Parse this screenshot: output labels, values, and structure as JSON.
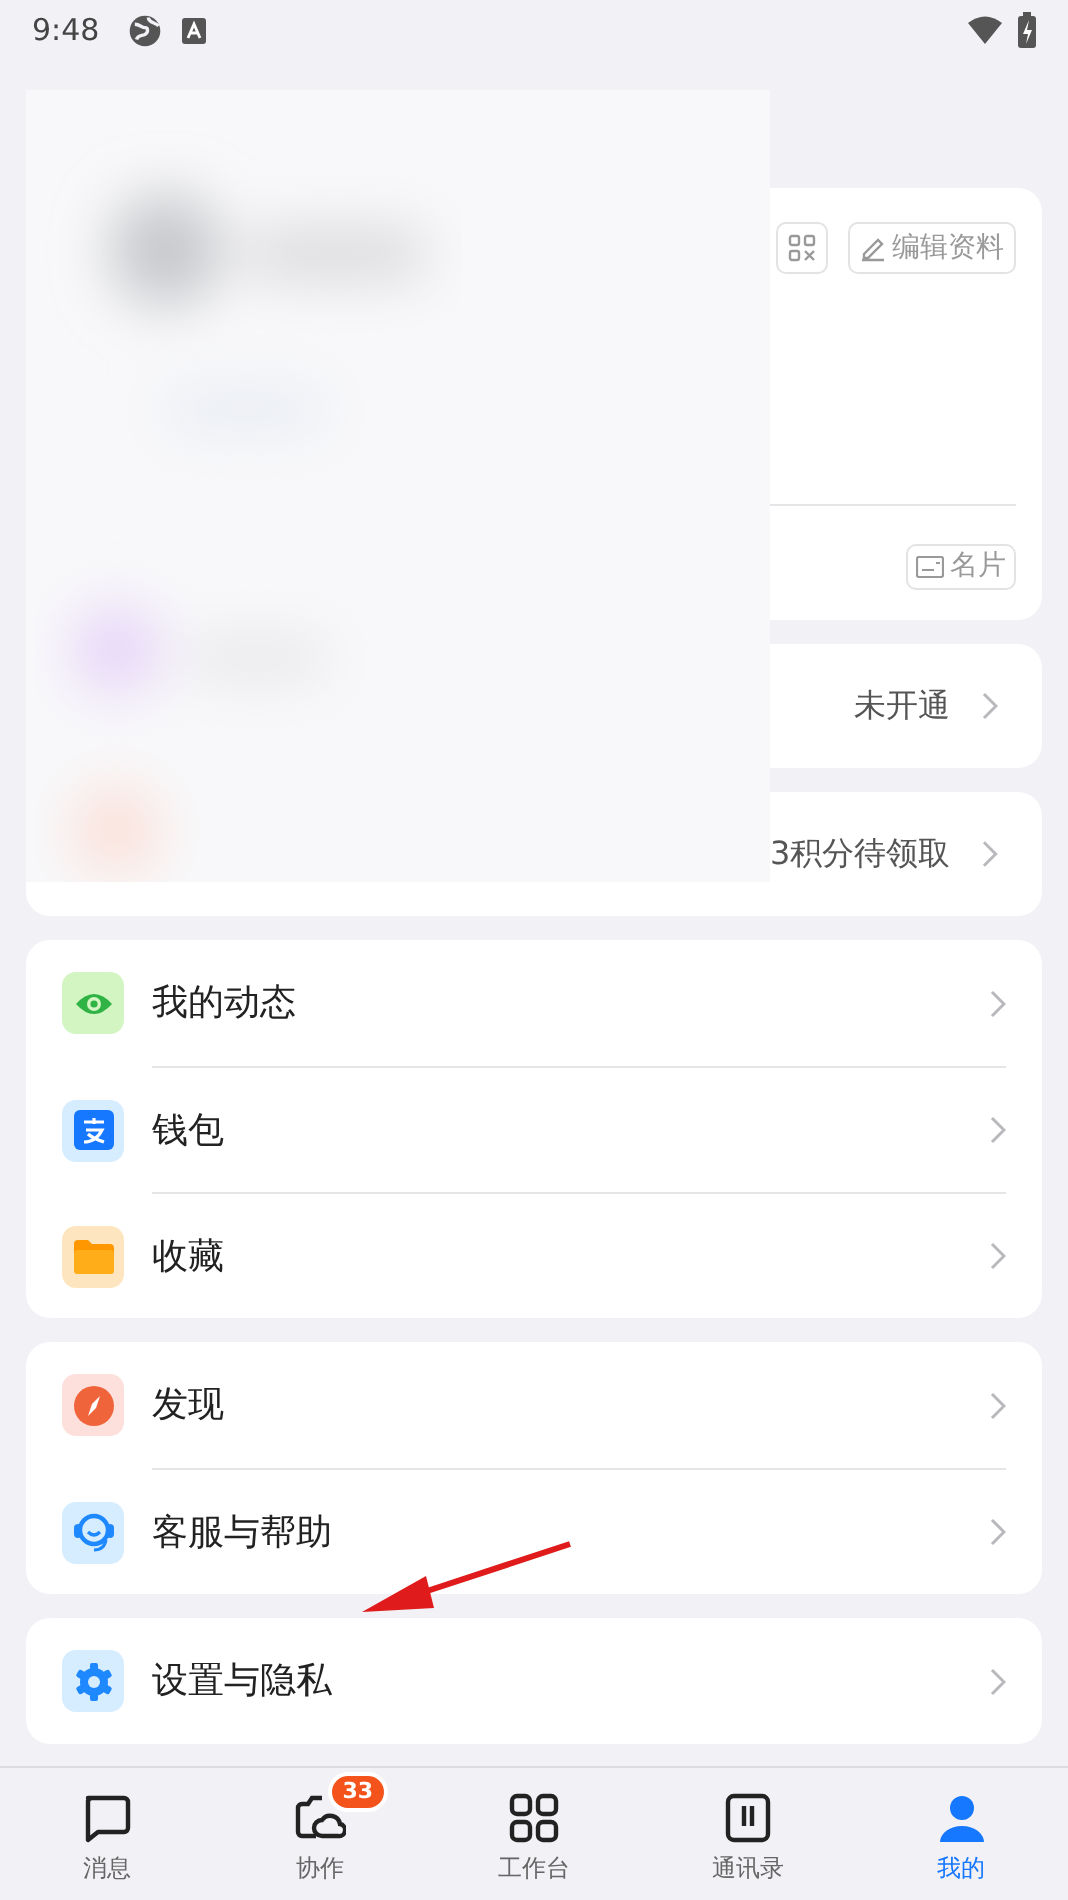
{
  "status_bar": {
    "time": "9:48"
  },
  "profile_card": {
    "edit_button": "编辑资料",
    "card_button": "名片"
  },
  "info_rows": [
    {
      "value": "未开通"
    },
    {
      "value": "3积分待领取"
    }
  ],
  "menu_groups": [
    [
      {
        "label": "我的动态"
      },
      {
        "label": "钱包"
      },
      {
        "label": "收藏"
      }
    ],
    [
      {
        "label": "发现"
      },
      {
        "label": "客服与帮助"
      }
    ],
    [
      {
        "label": "设置与隐私"
      }
    ]
  ],
  "tabs": [
    {
      "label": "消息",
      "selected": false
    },
    {
      "label": "协作",
      "selected": false,
      "badge": "33"
    },
    {
      "label": "工作台",
      "selected": false
    },
    {
      "label": "通讯录",
      "selected": false
    },
    {
      "label": "我的",
      "selected": true
    }
  ]
}
